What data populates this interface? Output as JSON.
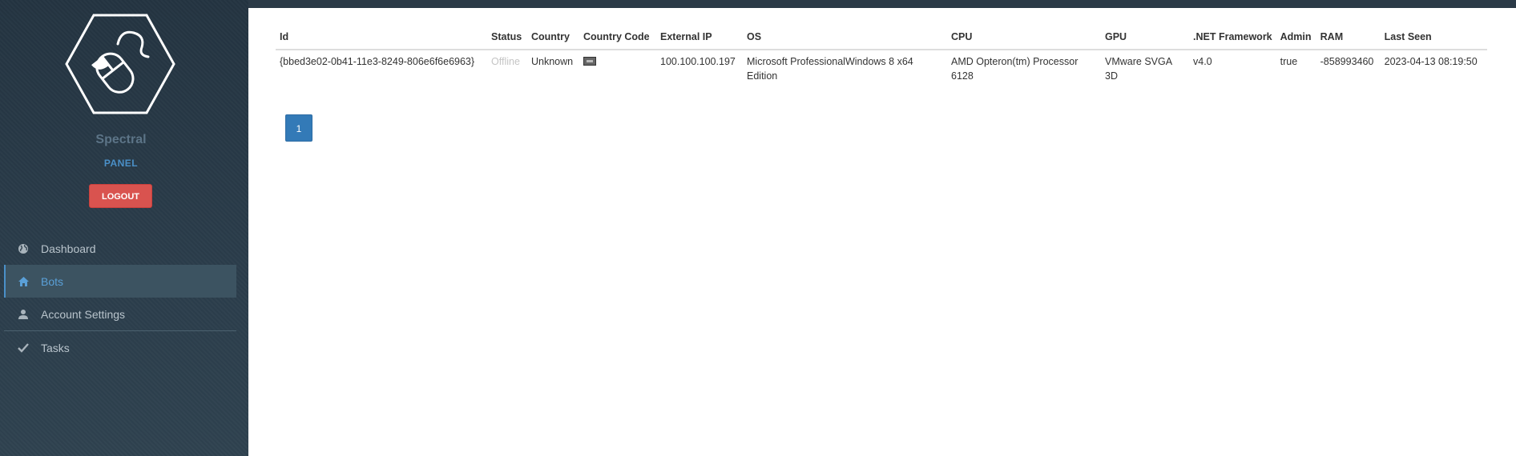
{
  "sidebar": {
    "brand_name": "Spectral",
    "brand_sub": "PANEL",
    "logout_label": "LOGOUT",
    "logo_icon": "mouse-hexagon-icon",
    "nav": [
      {
        "label": "Dashboard",
        "icon": "globe-icon",
        "active": false
      },
      {
        "label": "Bots",
        "icon": "home-icon",
        "active": true
      },
      {
        "label": "Account Settings",
        "icon": "user-icon",
        "active": false
      },
      {
        "label": "Tasks",
        "icon": "check-icon",
        "active": false
      }
    ]
  },
  "table": {
    "headers": [
      "Id",
      "Status",
      "Country",
      "Country Code",
      "External IP",
      "OS",
      "CPU",
      "GPU",
      ".NET Framework",
      "Admin",
      "RAM",
      "Last Seen"
    ],
    "rows": [
      {
        "id": "{bbed3e02-0b41-11e3-8249-806e6f6e6963}",
        "status": "Offline",
        "country": "Unknown",
        "country_code_icon": "flag-icon",
        "external_ip": "100.100.100.197",
        "os": "Microsoft ProfessionalWindows 8 x64 Edition",
        "cpu": "AMD Opteron(tm) Processor 6128",
        "gpu": "VMware SVGA 3D",
        "net_framework": "v4.0",
        "admin": "true",
        "ram": "-858993460",
        "last_seen": "2023-04-13 08:19:50"
      }
    ]
  },
  "pagination": {
    "current_page": "1"
  },
  "colors": {
    "accent": "#337ab7",
    "danger": "#d9534f",
    "sidebar_bg": "#2b3d4b",
    "nav_active": "#5aa0d8"
  }
}
